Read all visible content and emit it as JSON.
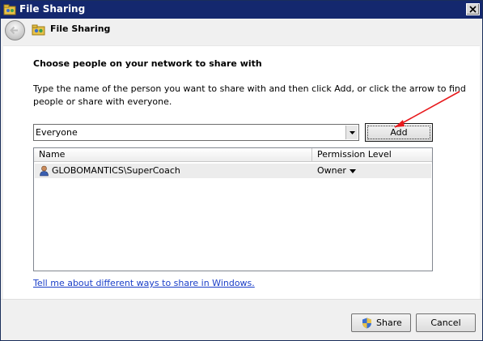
{
  "window": {
    "title": "File Sharing"
  },
  "navbar": {
    "title": "File Sharing"
  },
  "content": {
    "heading": "Choose people on your network to share with",
    "instructions": "Type the name of the person you want to share with and then click Add, or click the arrow to find people or share with everyone."
  },
  "combo": {
    "value": "Everyone"
  },
  "add_button": {
    "label": "Add"
  },
  "list": {
    "columns": [
      "Name",
      "Permission Level"
    ],
    "rows": [
      {
        "name": "GLOBOMANTICS\\SuperCoach",
        "permission": "Owner"
      }
    ]
  },
  "help_link": {
    "label": "Tell me about different ways to share in Windows."
  },
  "footer": {
    "share_label": "Share",
    "cancel_label": "Cancel"
  },
  "colors": {
    "titlebar": "#14286e",
    "annotation_arrow": "#e8191c",
    "link": "#1a3ec8"
  }
}
